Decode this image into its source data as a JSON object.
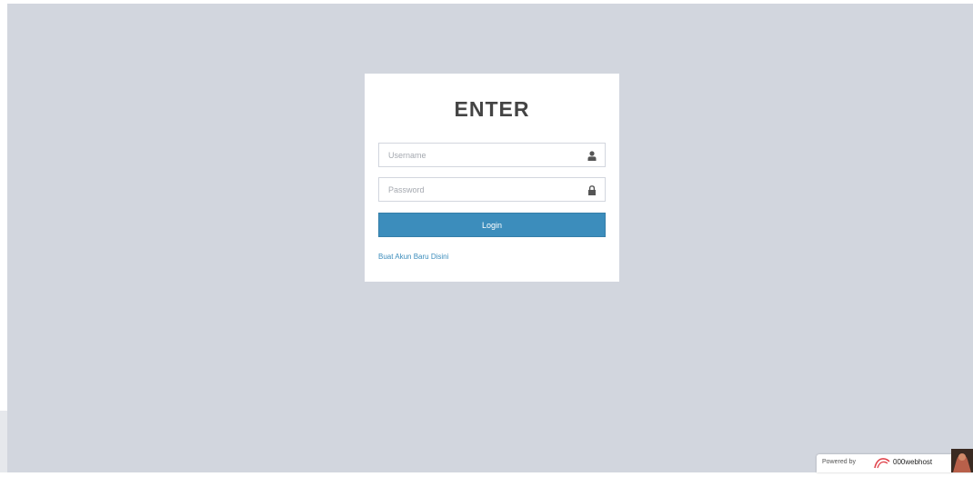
{
  "login": {
    "title": "ENTER",
    "username_placeholder": "Username",
    "password_placeholder": "Password",
    "login_button": "Login",
    "register_link": "Buat Akun Baru Disini"
  },
  "footer": {
    "powered_by": "Powered by",
    "brand": "000webhost"
  },
  "icons": {
    "username": "user-icon",
    "password": "lock-icon",
    "brand": "000webhost-logo-icon"
  },
  "colors": {
    "page_background": "#d2d6de",
    "box_background": "#ffffff",
    "button_primary": "#3c8dbc",
    "link": "#3c8dbc",
    "brand_accent": "#e0434b"
  }
}
